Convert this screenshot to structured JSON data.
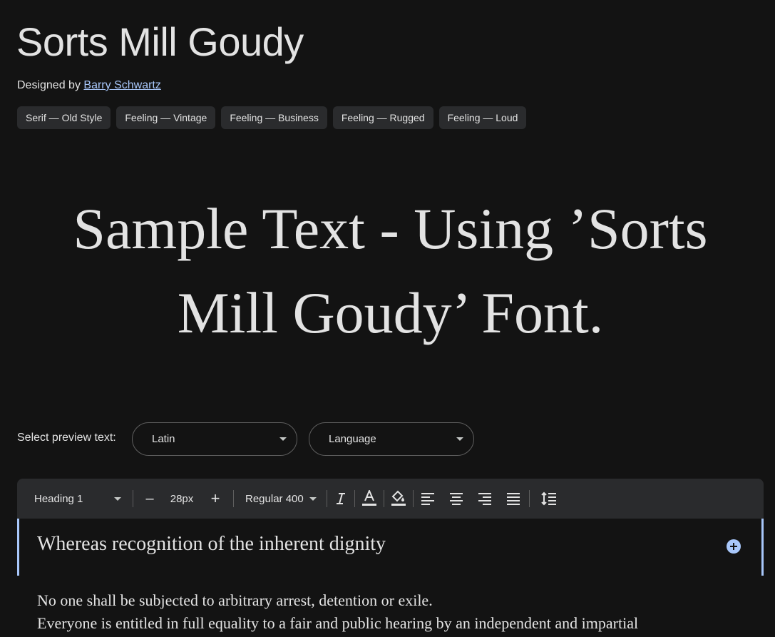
{
  "font": {
    "family_name": "Sorts Mill Goudy",
    "designed_by_label": "Designed by",
    "designer": "Barry Schwartz"
  },
  "tags": [
    "Serif — Old Style",
    "Feeling — Vintage",
    "Feeling — Business",
    "Feeling — Rugged",
    "Feeling — Loud"
  ],
  "sample": {
    "line1": "Sample Text - Using ’Sorts",
    "line2": "Mill Goudy’ Font."
  },
  "preview": {
    "label": "Select preview text:",
    "script_value": "Latin",
    "language_value": "Language"
  },
  "toolbar": {
    "style_value": "Heading 1",
    "size_value": "28px",
    "weight_value": "Regular 400",
    "decrease_glyph": "–",
    "increase_glyph": "+"
  },
  "editor": {
    "heading": "Whereas recognition of the inherent dignity",
    "body_lines": [
      "No one shall be subjected to arbitrary arrest, detention or exile.",
      "Everyone is entitled in full equality to a fair and public hearing by an independent and impartial"
    ]
  },
  "colors": {
    "background": "#131313",
    "surface": "#2a2b2d",
    "accent": "#a8c7fa",
    "text": "#e3e3e3"
  },
  "icons": [
    "chevron-down-icon",
    "italic-icon",
    "text-color-icon",
    "highlight-fill-icon",
    "align-left-icon",
    "align-center-icon",
    "align-right-icon",
    "align-justify-icon",
    "line-height-icon",
    "add-circle-icon"
  ]
}
